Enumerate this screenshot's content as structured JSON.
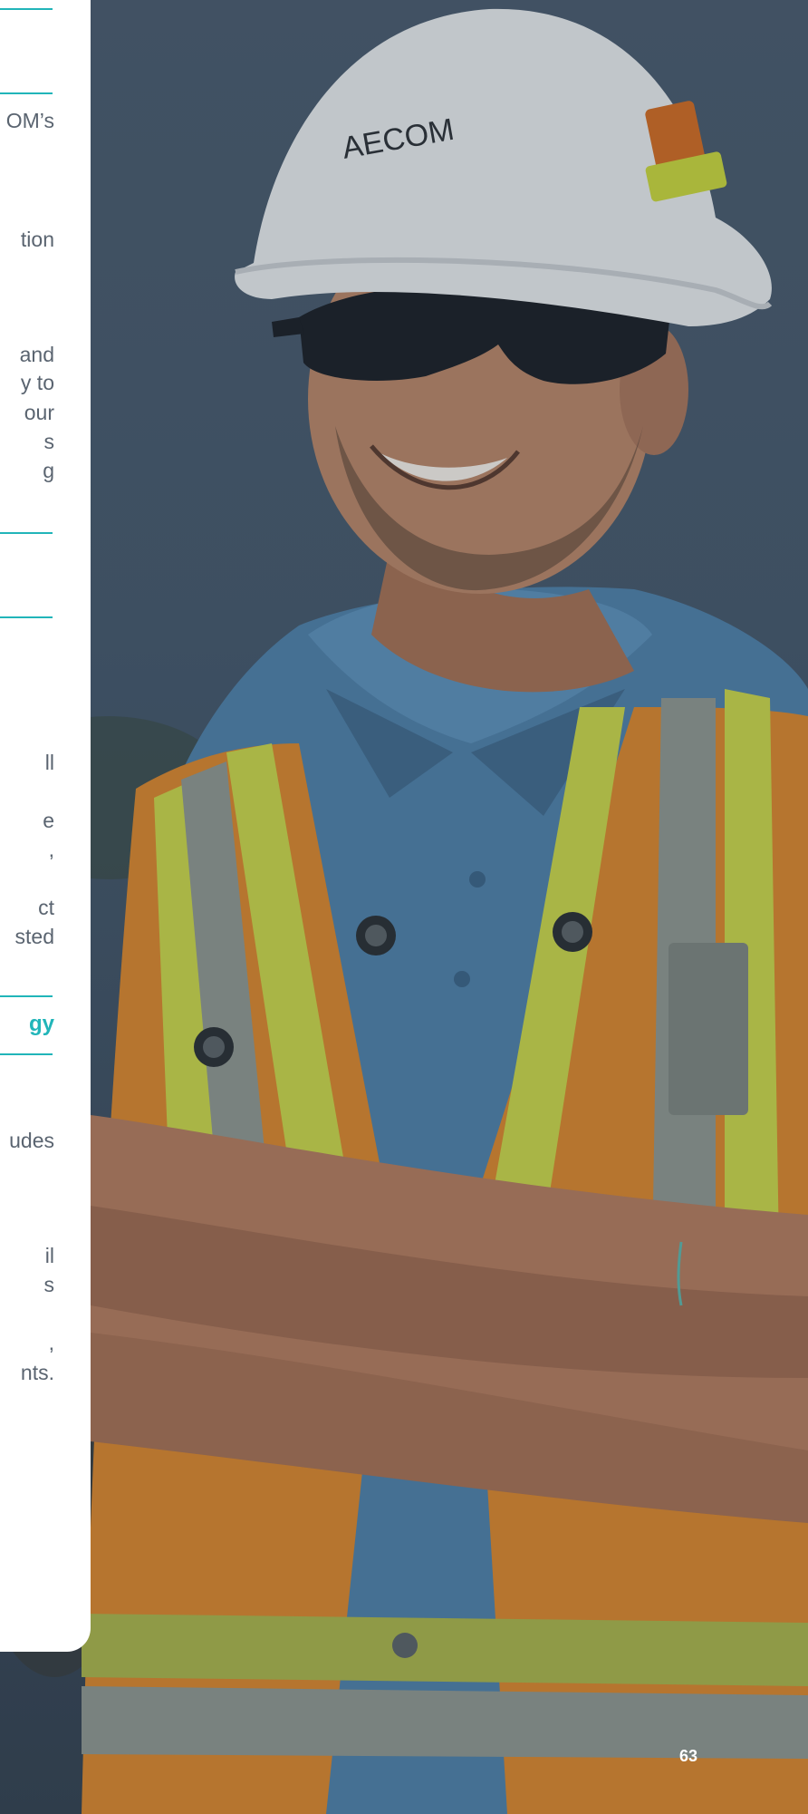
{
  "panel": {
    "fragments": [
      {
        "id": "f1",
        "text": "OM’s"
      },
      {
        "id": "f2",
        "text": "tion"
      },
      {
        "id": "f3",
        "text": "and"
      },
      {
        "id": "f4",
        "text": "y to"
      },
      {
        "id": "f5",
        "text": "our"
      },
      {
        "id": "f6",
        "text": "s"
      },
      {
        "id": "f7",
        "text": "g"
      },
      {
        "id": "f8",
        "text": "ll"
      },
      {
        "id": "f9",
        "text": "e"
      },
      {
        "id": "f10",
        "text": ","
      },
      {
        "id": "f11",
        "text": "ct"
      },
      {
        "id": "f12",
        "text": "sted"
      },
      {
        "id": "f13",
        "text": "gy"
      },
      {
        "id": "f14",
        "text": "udes"
      },
      {
        "id": "f15",
        "text": "il"
      },
      {
        "id": "f16",
        "text": "s"
      },
      {
        "id": "f17",
        "text": ","
      },
      {
        "id": "f18",
        "text": "nts."
      }
    ]
  },
  "helmet": {
    "brand": "AECOM"
  },
  "colors": {
    "accent": "#21b5b9",
    "body_text": "#5a6470",
    "panel_bg": "#ffffff"
  },
  "footer": {
    "page_number": "63"
  }
}
